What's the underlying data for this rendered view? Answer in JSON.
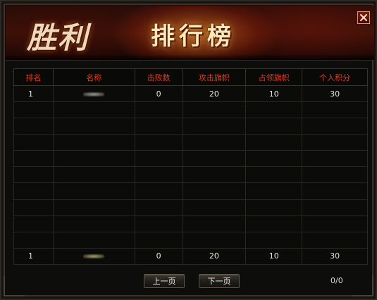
{
  "header": {
    "victory_title": "胜利",
    "panel_title": "排行榜",
    "close_icon": "close-icon"
  },
  "table": {
    "columns": [
      "排名",
      "名称",
      "击败数",
      "攻击旗帜",
      "占领旗帜",
      "个人积分"
    ],
    "rows": [
      {
        "rank": "1",
        "name": "",
        "defeats": "0",
        "attack_flags": "20",
        "occupy_flags": "10",
        "score": "30"
      }
    ],
    "self_row": {
      "rank": "1",
      "name": "",
      "defeats": "0",
      "attack_flags": "20",
      "occupy_flags": "10",
      "score": "30"
    }
  },
  "footer": {
    "prev_label": "上一页",
    "next_label": "下一页",
    "page_indicator": "0/0"
  },
  "colors": {
    "header_text": "#e03a1e",
    "cell_text": "#e8e8e0",
    "accent": "#8a1810"
  }
}
